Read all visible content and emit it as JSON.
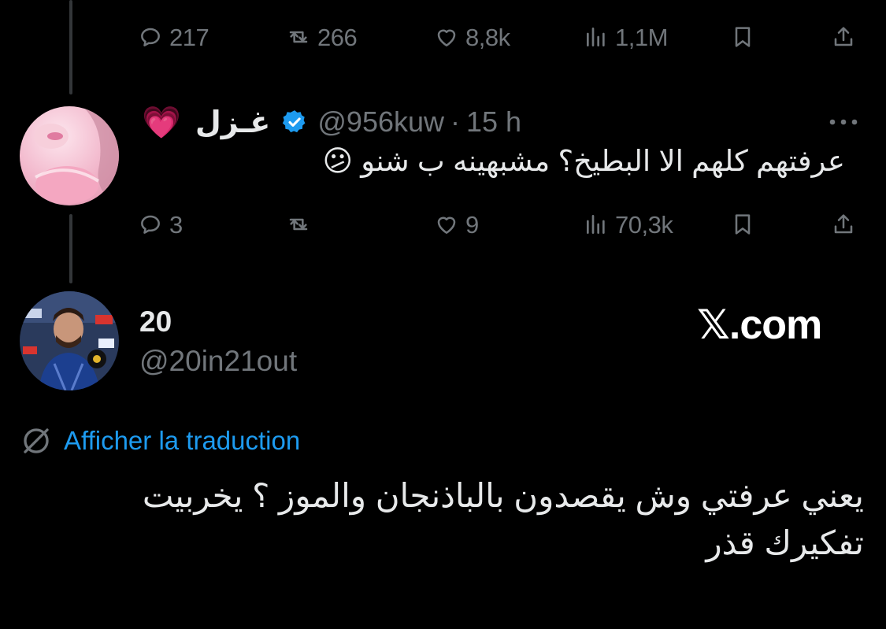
{
  "reply_parent_actions": {
    "replies": "217",
    "reposts": "266",
    "likes": "8,8k",
    "views": "1,1M"
  },
  "reply": {
    "emoji_prefix": "💗",
    "display_name": "غـزل",
    "handle": "@956kuw",
    "separator": "·",
    "time": "15 h",
    "text": "عرفتهم كلهم الا البطيخ؟ مشبهينه ب شنو 😕",
    "actions": {
      "replies": "3",
      "reposts": "",
      "likes": "9",
      "views": "70,3k"
    }
  },
  "tweet": {
    "display_name": "20",
    "handle": "@20in21out",
    "translate_label": "Afficher la traduction",
    "text_line1": "يعني عرفتي وش يقصدون بالباذنجان والموز ؟ يخربيت",
    "text_line2": "تفكيرك قذر"
  },
  "watermark": "𝕏.com",
  "colors": {
    "background": "#000000",
    "text": "#e7e9ea",
    "muted": "#71767b",
    "link": "#1d9bf0",
    "verified": "#1d9bf0"
  }
}
